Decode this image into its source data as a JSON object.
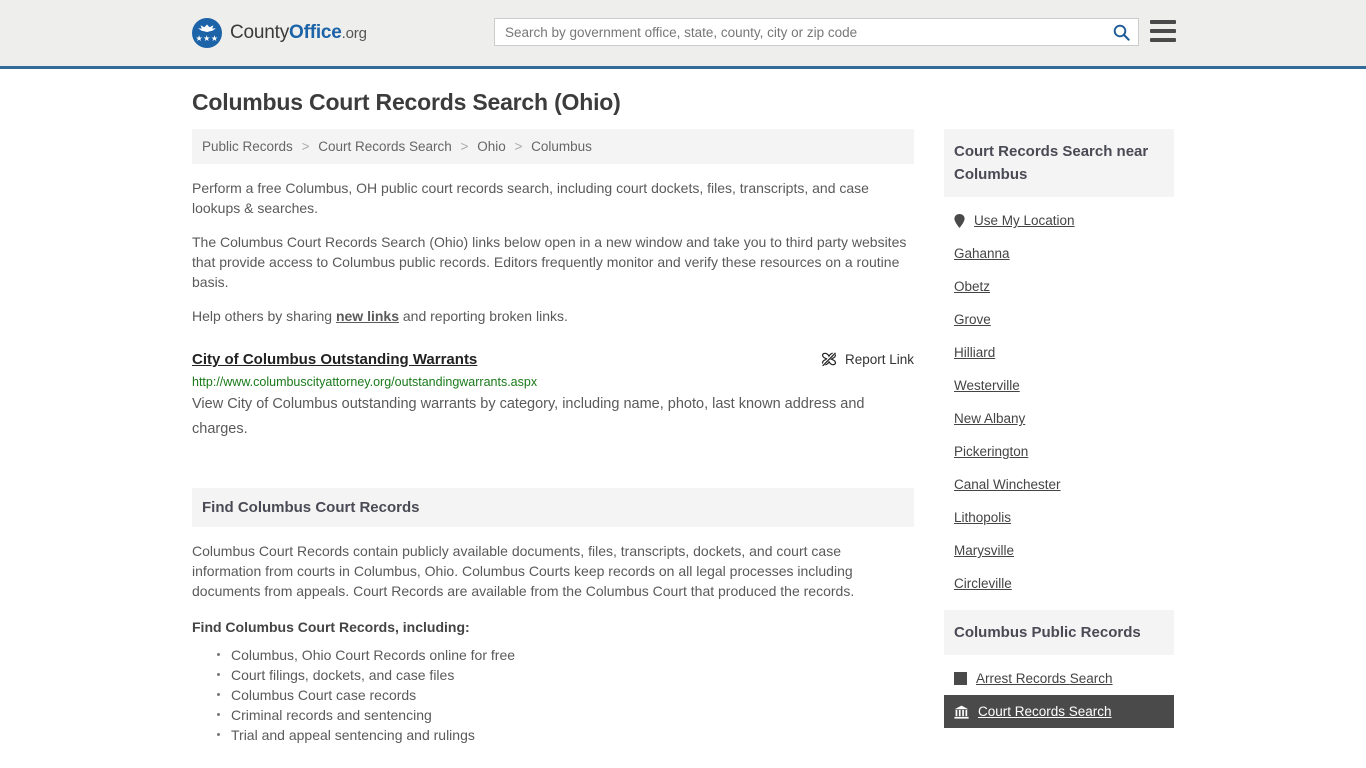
{
  "header": {
    "brand": {
      "part1": "County",
      "part2": "Office",
      "part3": ".org",
      "logo_icon": "eagle-stars-logo",
      "stars": "★★★"
    },
    "search": {
      "placeholder": "Search by government office, state, county, city or zip code",
      "value": "",
      "icon": "search-icon"
    },
    "menu": {
      "icon": "hamburger-menu-icon"
    },
    "accent_color": "#336c99"
  },
  "page": {
    "title": "Columbus Court Records Search (Ohio)"
  },
  "breadcrumb": {
    "separator": ">",
    "items": [
      {
        "label": "Public Records"
      },
      {
        "label": "Court Records Search"
      },
      {
        "label": "Ohio"
      },
      {
        "label": "Columbus"
      }
    ]
  },
  "intro": {
    "p1": "Perform a free Columbus, OH public court records search, including court dockets, files, transcripts, and case lookups & searches.",
    "p2": "The Columbus Court Records Search (Ohio) links below open in a new window and take you to third party websites that provide access to Columbus public records. Editors frequently monitor and verify these resources on a routine basis.",
    "p3_before": "Help others by sharing ",
    "p3_link": "new links",
    "p3_after": " and reporting broken links."
  },
  "result": {
    "title": "City of Columbus Outstanding Warrants",
    "url": "http://www.columbuscityattorney.org/outstandingwarrants.aspx",
    "description": "View City of Columbus outstanding warrants by category, including name, photo, last known address and charges.",
    "report_label": "Report Link",
    "report_icon": "broken-link-icon",
    "url_color": "#1a7a1a"
  },
  "section": {
    "heading": "Find Columbus Court Records",
    "paragraph": "Columbus Court Records contain publicly available documents, files, transcripts, dockets, and court case information from courts in Columbus, Ohio. Columbus Courts keep records on all legal processes including documents from appeals. Court Records are available from the Columbus Court that produced the records.",
    "list_intro": "Find Columbus Court Records, including:",
    "bullets": [
      "Columbus, Ohio Court Records online for free",
      "Court filings, dockets, and case files",
      "Columbus Court case records",
      "Criminal records and sentencing",
      "Trial and appeal sentencing and rulings"
    ]
  },
  "sidebar": {
    "nearby": {
      "heading": "Court Records Search near Columbus",
      "items": [
        {
          "label": "Use My Location",
          "icon": "map-pin-icon"
        },
        {
          "label": "Gahanna",
          "icon": ""
        },
        {
          "label": "Obetz",
          "icon": ""
        },
        {
          "label": "Grove",
          "icon": ""
        },
        {
          "label": "Hilliard",
          "icon": ""
        },
        {
          "label": "Westerville",
          "icon": ""
        },
        {
          "label": "New Albany",
          "icon": ""
        },
        {
          "label": "Pickerington",
          "icon": ""
        },
        {
          "label": "Canal Winchester",
          "icon": ""
        },
        {
          "label": "Lithopolis",
          "icon": ""
        },
        {
          "label": "Marysville",
          "icon": ""
        },
        {
          "label": "Circleville",
          "icon": ""
        }
      ]
    },
    "public_records": {
      "heading": "Columbus Public Records",
      "items": [
        {
          "label": "Arrest Records Search",
          "icon": "fingerprint-square-icon",
          "active": false
        },
        {
          "label": "Court Records Search",
          "icon": "courthouse-icon",
          "active": true
        }
      ],
      "active_bg": "#4a4a4a"
    }
  }
}
